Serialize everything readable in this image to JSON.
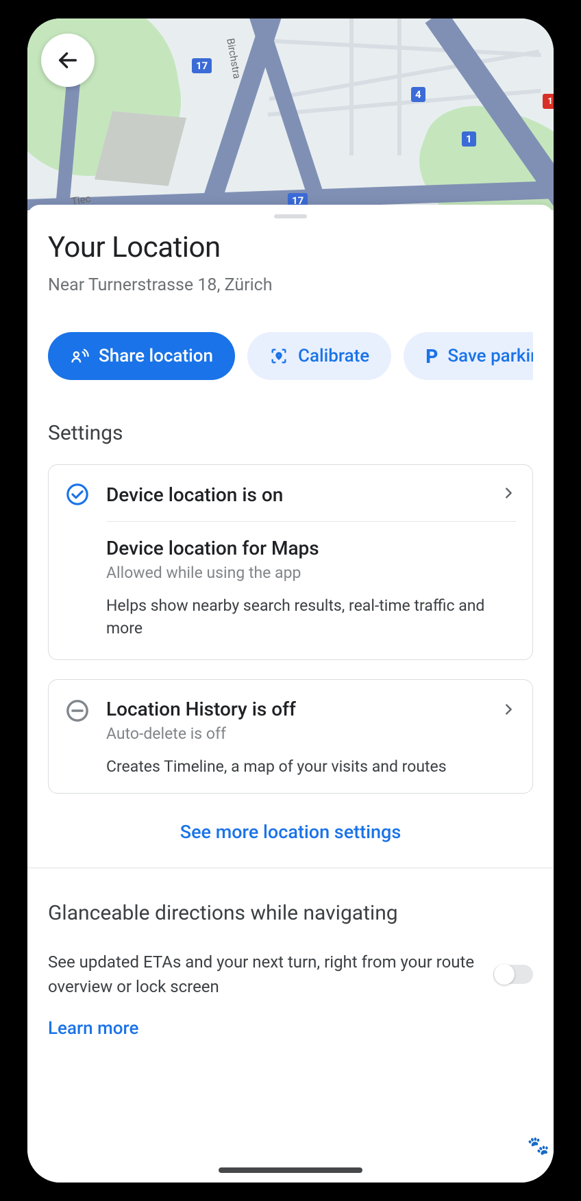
{
  "map": {
    "shields": [
      "17",
      "4",
      "1",
      "17"
    ],
    "red_shield": "1",
    "street_label_1": "Birchstra",
    "street_label_2": "Tiec"
  },
  "header": {
    "title": "Your Location",
    "subtitle": "Near Turnerstrasse 18, Zürich"
  },
  "chips": {
    "share": "Share location",
    "calibrate": "Calibrate",
    "save_parking": "Save parkin"
  },
  "settings": {
    "heading": "Settings",
    "device_location": {
      "title": "Device location is on",
      "maps_title": "Device location for Maps",
      "maps_sub": "Allowed while using the app",
      "maps_desc": "Helps show nearby search results, real-time traffic and more"
    },
    "history": {
      "title": "Location History is off",
      "sub": "Auto-delete is off",
      "desc": "Creates Timeline, a map of your visits and routes"
    },
    "more": "See more location settings"
  },
  "glanceable": {
    "title": "Glanceable directions while navigating",
    "desc": "See updated ETAs and your next turn, right from your route overview or lock screen",
    "learn": "Learn more"
  },
  "icons": {
    "back": "back-arrow-icon",
    "share": "share-location-icon",
    "calibrate": "calibrate-icon",
    "parking": "parking-icon",
    "check": "check-circle-icon",
    "off": "minus-circle-icon",
    "chevron": "chevron-right-icon"
  }
}
